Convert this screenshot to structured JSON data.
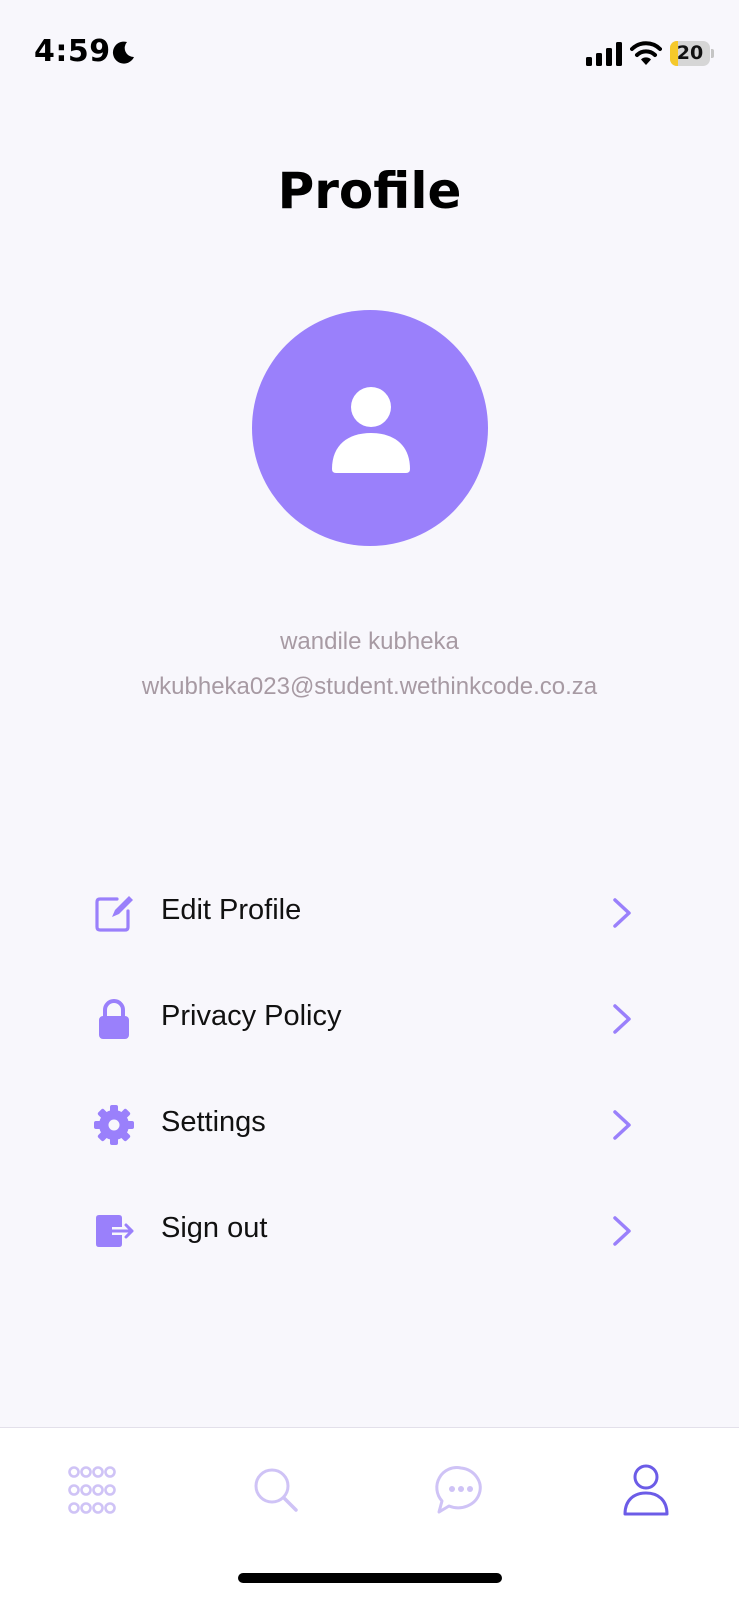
{
  "status_bar": {
    "time": "4:59",
    "battery_level": "20",
    "battery_fraction": 0.2
  },
  "page": {
    "title": "Profile"
  },
  "profile": {
    "name": "wandile kubheka",
    "email": "wkubheka023@student.wethinkcode.co.za"
  },
  "menu": {
    "items": [
      {
        "label": "Edit Profile",
        "icon": "edit-icon"
      },
      {
        "label": "Privacy Policy",
        "icon": "lock-icon"
      },
      {
        "label": "Settings",
        "icon": "gear-icon"
      },
      {
        "label": "Sign out",
        "icon": "sign-out-icon"
      }
    ]
  },
  "tab_bar": {
    "tabs": [
      {
        "icon": "grid-icon",
        "active": false
      },
      {
        "icon": "search-icon",
        "active": false
      },
      {
        "icon": "chat-icon",
        "active": false
      },
      {
        "icon": "profile-icon",
        "active": true
      }
    ]
  },
  "colors": {
    "accent": "#9a80fb",
    "accent_dark": "#6c5ce7",
    "inactive_tab": "#cfc3f6",
    "secondary_text": "#a79aa3",
    "background": "#f8f7fc"
  }
}
